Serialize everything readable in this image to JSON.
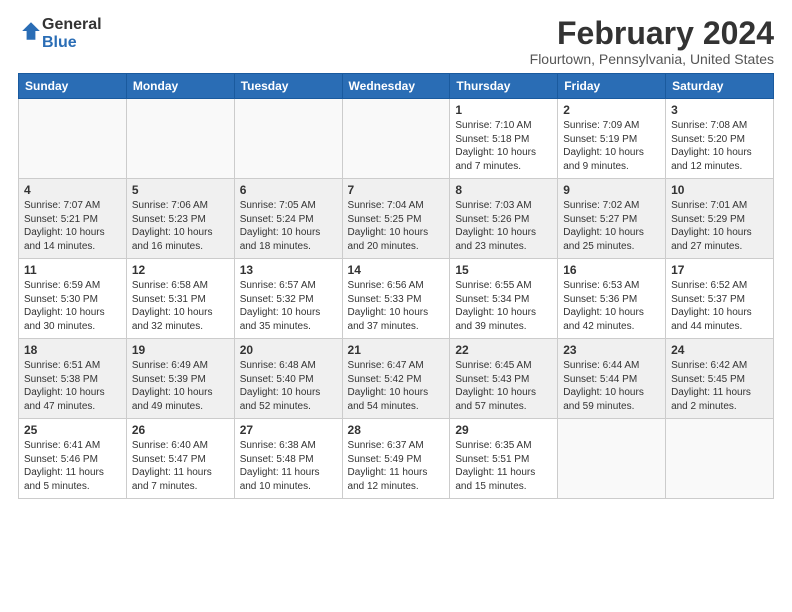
{
  "logo": {
    "line1": "General",
    "line2": "Blue"
  },
  "header": {
    "month": "February 2024",
    "location": "Flourtown, Pennsylvania, United States"
  },
  "days_of_week": [
    "Sunday",
    "Monday",
    "Tuesday",
    "Wednesday",
    "Thursday",
    "Friday",
    "Saturday"
  ],
  "weeks": [
    [
      {
        "day": "",
        "info": ""
      },
      {
        "day": "",
        "info": ""
      },
      {
        "day": "",
        "info": ""
      },
      {
        "day": "",
        "info": ""
      },
      {
        "day": "1",
        "info": "Sunrise: 7:10 AM\nSunset: 5:18 PM\nDaylight: 10 hours\nand 7 minutes."
      },
      {
        "day": "2",
        "info": "Sunrise: 7:09 AM\nSunset: 5:19 PM\nDaylight: 10 hours\nand 9 minutes."
      },
      {
        "day": "3",
        "info": "Sunrise: 7:08 AM\nSunset: 5:20 PM\nDaylight: 10 hours\nand 12 minutes."
      }
    ],
    [
      {
        "day": "4",
        "info": "Sunrise: 7:07 AM\nSunset: 5:21 PM\nDaylight: 10 hours\nand 14 minutes."
      },
      {
        "day": "5",
        "info": "Sunrise: 7:06 AM\nSunset: 5:23 PM\nDaylight: 10 hours\nand 16 minutes."
      },
      {
        "day": "6",
        "info": "Sunrise: 7:05 AM\nSunset: 5:24 PM\nDaylight: 10 hours\nand 18 minutes."
      },
      {
        "day": "7",
        "info": "Sunrise: 7:04 AM\nSunset: 5:25 PM\nDaylight: 10 hours\nand 20 minutes."
      },
      {
        "day": "8",
        "info": "Sunrise: 7:03 AM\nSunset: 5:26 PM\nDaylight: 10 hours\nand 23 minutes."
      },
      {
        "day": "9",
        "info": "Sunrise: 7:02 AM\nSunset: 5:27 PM\nDaylight: 10 hours\nand 25 minutes."
      },
      {
        "day": "10",
        "info": "Sunrise: 7:01 AM\nSunset: 5:29 PM\nDaylight: 10 hours\nand 27 minutes."
      }
    ],
    [
      {
        "day": "11",
        "info": "Sunrise: 6:59 AM\nSunset: 5:30 PM\nDaylight: 10 hours\nand 30 minutes."
      },
      {
        "day": "12",
        "info": "Sunrise: 6:58 AM\nSunset: 5:31 PM\nDaylight: 10 hours\nand 32 minutes."
      },
      {
        "day": "13",
        "info": "Sunrise: 6:57 AM\nSunset: 5:32 PM\nDaylight: 10 hours\nand 35 minutes."
      },
      {
        "day": "14",
        "info": "Sunrise: 6:56 AM\nSunset: 5:33 PM\nDaylight: 10 hours\nand 37 minutes."
      },
      {
        "day": "15",
        "info": "Sunrise: 6:55 AM\nSunset: 5:34 PM\nDaylight: 10 hours\nand 39 minutes."
      },
      {
        "day": "16",
        "info": "Sunrise: 6:53 AM\nSunset: 5:36 PM\nDaylight: 10 hours\nand 42 minutes."
      },
      {
        "day": "17",
        "info": "Sunrise: 6:52 AM\nSunset: 5:37 PM\nDaylight: 10 hours\nand 44 minutes."
      }
    ],
    [
      {
        "day": "18",
        "info": "Sunrise: 6:51 AM\nSunset: 5:38 PM\nDaylight: 10 hours\nand 47 minutes."
      },
      {
        "day": "19",
        "info": "Sunrise: 6:49 AM\nSunset: 5:39 PM\nDaylight: 10 hours\nand 49 minutes."
      },
      {
        "day": "20",
        "info": "Sunrise: 6:48 AM\nSunset: 5:40 PM\nDaylight: 10 hours\nand 52 minutes."
      },
      {
        "day": "21",
        "info": "Sunrise: 6:47 AM\nSunset: 5:42 PM\nDaylight: 10 hours\nand 54 minutes."
      },
      {
        "day": "22",
        "info": "Sunrise: 6:45 AM\nSunset: 5:43 PM\nDaylight: 10 hours\nand 57 minutes."
      },
      {
        "day": "23",
        "info": "Sunrise: 6:44 AM\nSunset: 5:44 PM\nDaylight: 10 hours\nand 59 minutes."
      },
      {
        "day": "24",
        "info": "Sunrise: 6:42 AM\nSunset: 5:45 PM\nDaylight: 11 hours\nand 2 minutes."
      }
    ],
    [
      {
        "day": "25",
        "info": "Sunrise: 6:41 AM\nSunset: 5:46 PM\nDaylight: 11 hours\nand 5 minutes."
      },
      {
        "day": "26",
        "info": "Sunrise: 6:40 AM\nSunset: 5:47 PM\nDaylight: 11 hours\nand 7 minutes."
      },
      {
        "day": "27",
        "info": "Sunrise: 6:38 AM\nSunset: 5:48 PM\nDaylight: 11 hours\nand 10 minutes."
      },
      {
        "day": "28",
        "info": "Sunrise: 6:37 AM\nSunset: 5:49 PM\nDaylight: 11 hours\nand 12 minutes."
      },
      {
        "day": "29",
        "info": "Sunrise: 6:35 AM\nSunset: 5:51 PM\nDaylight: 11 hours\nand 15 minutes."
      },
      {
        "day": "",
        "info": ""
      },
      {
        "day": "",
        "info": ""
      }
    ]
  ]
}
